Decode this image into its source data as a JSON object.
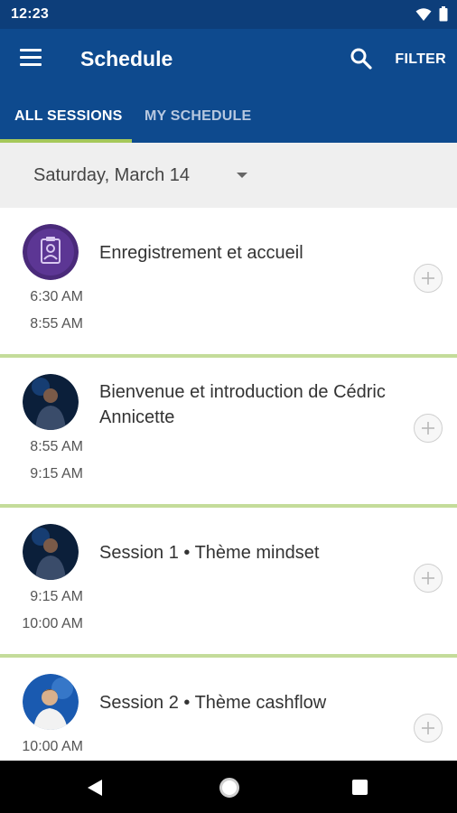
{
  "status": {
    "time": "12:23",
    "icons": [
      "wifi-icon",
      "battery-icon"
    ]
  },
  "appbar": {
    "title": "Schedule",
    "filter_label": "FILTER",
    "icons": [
      "menu-icon",
      "search-icon"
    ]
  },
  "tabs": [
    {
      "label": "ALL SESSIONS",
      "active": true
    },
    {
      "label": "MY SCHEDULE",
      "active": false
    }
  ],
  "date_selector": {
    "value": "Saturday, March 14"
  },
  "sessions": [
    {
      "title": "Enregistrement et accueil",
      "start": "6:30 AM",
      "end": "8:55 AM",
      "avatar": "registration-icon"
    },
    {
      "title": "Bienvenue et introduction de Cédric Annicette",
      "start": "8:55 AM",
      "end": "9:15 AM",
      "avatar": "speaker-photo"
    },
    {
      "title": "Session 1 • Thème mindset",
      "start": "9:15 AM",
      "end": "10:00 AM",
      "avatar": "speaker-photo"
    },
    {
      "title": "Session 2 • Thème cashflow",
      "start": "10:00 AM",
      "end": "",
      "avatar": "speaker-photo"
    }
  ],
  "colors": {
    "appbar": "#0e4a8e",
    "statusbar": "#0d3e7a",
    "accent": "#a5c85a",
    "separator": "#c4dc9a"
  },
  "nav": {
    "icons": [
      "back-icon",
      "home-icon",
      "recent-apps-icon"
    ]
  }
}
